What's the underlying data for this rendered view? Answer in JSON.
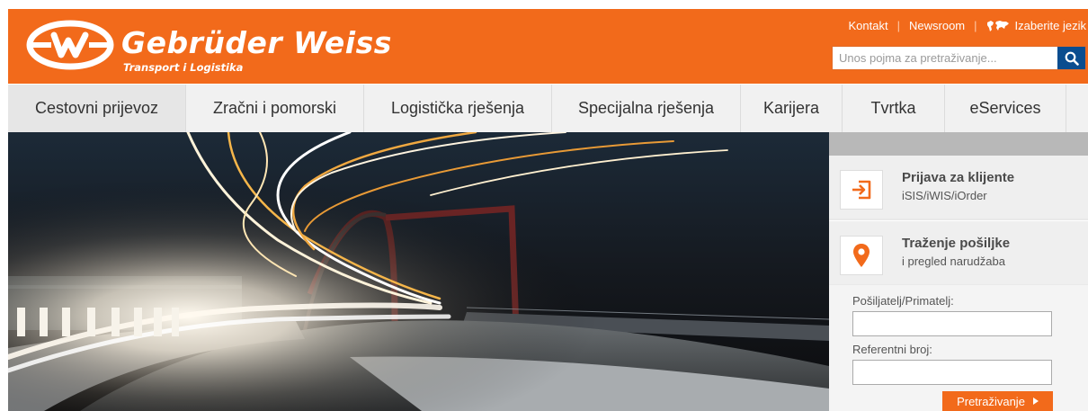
{
  "brand": {
    "name": "Gebrüder Weiss",
    "tagline": "Transport i Logistika"
  },
  "top_links": {
    "contact": "Kontakt",
    "newsroom": "Newsroom",
    "language": "Izaberite jezik"
  },
  "search": {
    "placeholder": "Unos pojma za pretraživanje..."
  },
  "nav": {
    "items": [
      {
        "label": "Cestovni prijevoz"
      },
      {
        "label": "Zračni i pomorski"
      },
      {
        "label": "Logistička rješenja"
      },
      {
        "label": "Specijalna rješenja"
      },
      {
        "label": "Karijera"
      },
      {
        "label": "Tvrtka"
      },
      {
        "label": "eServices"
      }
    ],
    "active_index": 0
  },
  "panel": {
    "login": {
      "title": "Prijava za klijente",
      "subtitle": "iSIS/iWIS/iOrder"
    },
    "tracking": {
      "title": "Traženje pošiljke",
      "subtitle": "i pregled narudžaba"
    },
    "form": {
      "sender_label": "Pošiljatelj/Primatelj:",
      "reference_label": "Referentni broj:",
      "submit_label": "Pretraživanje"
    }
  },
  "colors": {
    "brand_orange": "#f26a1b",
    "search_button": "#0a4d8f"
  },
  "icons": {
    "logo": "gw-logo-mark",
    "search": "search-icon",
    "language": "world-map-icon",
    "login": "login-arrow-icon",
    "tracking": "map-pin-icon",
    "submit": "triangle-right-icon"
  }
}
